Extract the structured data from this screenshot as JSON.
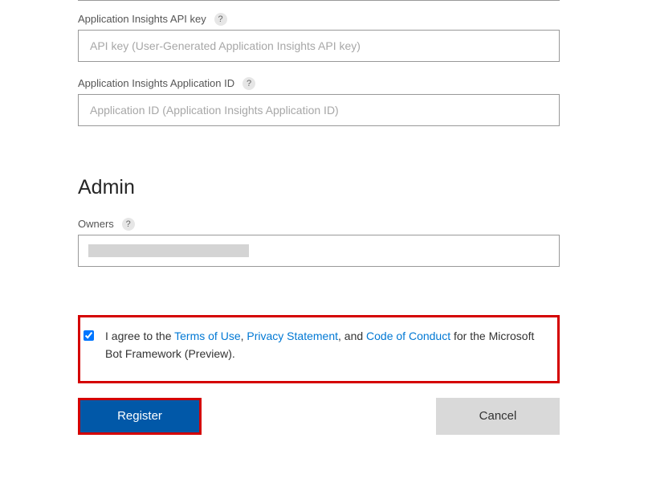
{
  "fields": {
    "api_key": {
      "label": "Application Insights API key",
      "placeholder": "API key (User-Generated Application Insights API key)",
      "value": ""
    },
    "app_id": {
      "label": "Application Insights Application ID",
      "placeholder": "Application ID (Application Insights Application ID)",
      "value": ""
    },
    "owners": {
      "label": "Owners"
    }
  },
  "section": {
    "admin_heading": "Admin"
  },
  "agreement": {
    "checked": true,
    "pre": "I agree to the ",
    "terms": "Terms of Use",
    "comma1": ", ",
    "privacy": "Privacy Statement",
    "comma2": ", and ",
    "conduct": "Code of Conduct",
    "post": " for the Microsoft Bot Framework (Preview)."
  },
  "buttons": {
    "register": "Register",
    "cancel": "Cancel"
  },
  "help_glyph": "?"
}
